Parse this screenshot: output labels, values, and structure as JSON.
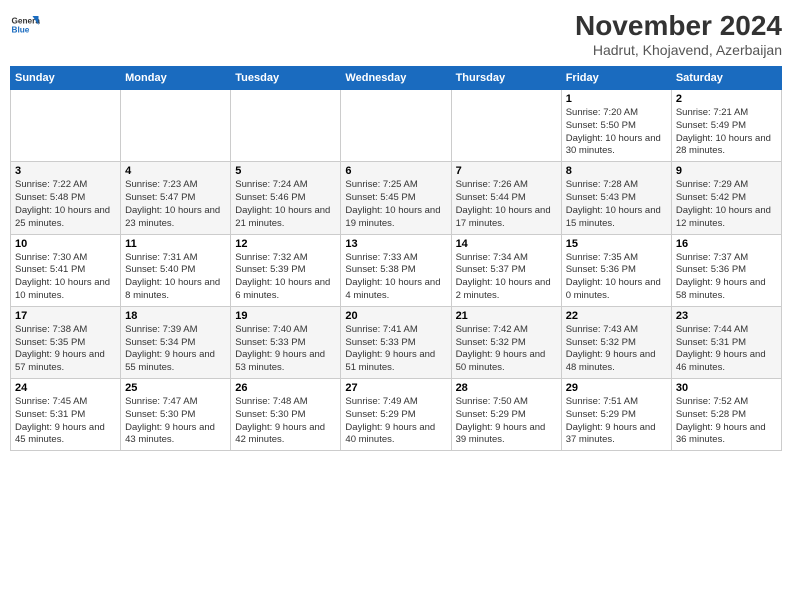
{
  "logo": {
    "general": "General",
    "blue": "Blue"
  },
  "title": "November 2024",
  "subtitle": "Hadrut, Khojavend, Azerbaijan",
  "days_of_week": [
    "Sunday",
    "Monday",
    "Tuesday",
    "Wednesday",
    "Thursday",
    "Friday",
    "Saturday"
  ],
  "weeks": [
    [
      {
        "day": "",
        "detail": ""
      },
      {
        "day": "",
        "detail": ""
      },
      {
        "day": "",
        "detail": ""
      },
      {
        "day": "",
        "detail": ""
      },
      {
        "day": "",
        "detail": ""
      },
      {
        "day": "1",
        "detail": "Sunrise: 7:20 AM\nSunset: 5:50 PM\nDaylight: 10 hours and 30 minutes."
      },
      {
        "day": "2",
        "detail": "Sunrise: 7:21 AM\nSunset: 5:49 PM\nDaylight: 10 hours and 28 minutes."
      }
    ],
    [
      {
        "day": "3",
        "detail": "Sunrise: 7:22 AM\nSunset: 5:48 PM\nDaylight: 10 hours and 25 minutes."
      },
      {
        "day": "4",
        "detail": "Sunrise: 7:23 AM\nSunset: 5:47 PM\nDaylight: 10 hours and 23 minutes."
      },
      {
        "day": "5",
        "detail": "Sunrise: 7:24 AM\nSunset: 5:46 PM\nDaylight: 10 hours and 21 minutes."
      },
      {
        "day": "6",
        "detail": "Sunrise: 7:25 AM\nSunset: 5:45 PM\nDaylight: 10 hours and 19 minutes."
      },
      {
        "day": "7",
        "detail": "Sunrise: 7:26 AM\nSunset: 5:44 PM\nDaylight: 10 hours and 17 minutes."
      },
      {
        "day": "8",
        "detail": "Sunrise: 7:28 AM\nSunset: 5:43 PM\nDaylight: 10 hours and 15 minutes."
      },
      {
        "day": "9",
        "detail": "Sunrise: 7:29 AM\nSunset: 5:42 PM\nDaylight: 10 hours and 12 minutes."
      }
    ],
    [
      {
        "day": "10",
        "detail": "Sunrise: 7:30 AM\nSunset: 5:41 PM\nDaylight: 10 hours and 10 minutes."
      },
      {
        "day": "11",
        "detail": "Sunrise: 7:31 AM\nSunset: 5:40 PM\nDaylight: 10 hours and 8 minutes."
      },
      {
        "day": "12",
        "detail": "Sunrise: 7:32 AM\nSunset: 5:39 PM\nDaylight: 10 hours and 6 minutes."
      },
      {
        "day": "13",
        "detail": "Sunrise: 7:33 AM\nSunset: 5:38 PM\nDaylight: 10 hours and 4 minutes."
      },
      {
        "day": "14",
        "detail": "Sunrise: 7:34 AM\nSunset: 5:37 PM\nDaylight: 10 hours and 2 minutes."
      },
      {
        "day": "15",
        "detail": "Sunrise: 7:35 AM\nSunset: 5:36 PM\nDaylight: 10 hours and 0 minutes."
      },
      {
        "day": "16",
        "detail": "Sunrise: 7:37 AM\nSunset: 5:36 PM\nDaylight: 9 hours and 58 minutes."
      }
    ],
    [
      {
        "day": "17",
        "detail": "Sunrise: 7:38 AM\nSunset: 5:35 PM\nDaylight: 9 hours and 57 minutes."
      },
      {
        "day": "18",
        "detail": "Sunrise: 7:39 AM\nSunset: 5:34 PM\nDaylight: 9 hours and 55 minutes."
      },
      {
        "day": "19",
        "detail": "Sunrise: 7:40 AM\nSunset: 5:33 PM\nDaylight: 9 hours and 53 minutes."
      },
      {
        "day": "20",
        "detail": "Sunrise: 7:41 AM\nSunset: 5:33 PM\nDaylight: 9 hours and 51 minutes."
      },
      {
        "day": "21",
        "detail": "Sunrise: 7:42 AM\nSunset: 5:32 PM\nDaylight: 9 hours and 50 minutes."
      },
      {
        "day": "22",
        "detail": "Sunrise: 7:43 AM\nSunset: 5:32 PM\nDaylight: 9 hours and 48 minutes."
      },
      {
        "day": "23",
        "detail": "Sunrise: 7:44 AM\nSunset: 5:31 PM\nDaylight: 9 hours and 46 minutes."
      }
    ],
    [
      {
        "day": "24",
        "detail": "Sunrise: 7:45 AM\nSunset: 5:31 PM\nDaylight: 9 hours and 45 minutes."
      },
      {
        "day": "25",
        "detail": "Sunrise: 7:47 AM\nSunset: 5:30 PM\nDaylight: 9 hours and 43 minutes."
      },
      {
        "day": "26",
        "detail": "Sunrise: 7:48 AM\nSunset: 5:30 PM\nDaylight: 9 hours and 42 minutes."
      },
      {
        "day": "27",
        "detail": "Sunrise: 7:49 AM\nSunset: 5:29 PM\nDaylight: 9 hours and 40 minutes."
      },
      {
        "day": "28",
        "detail": "Sunrise: 7:50 AM\nSunset: 5:29 PM\nDaylight: 9 hours and 39 minutes."
      },
      {
        "day": "29",
        "detail": "Sunrise: 7:51 AM\nSunset: 5:29 PM\nDaylight: 9 hours and 37 minutes."
      },
      {
        "day": "30",
        "detail": "Sunrise: 7:52 AM\nSunset: 5:28 PM\nDaylight: 9 hours and 36 minutes."
      }
    ]
  ]
}
